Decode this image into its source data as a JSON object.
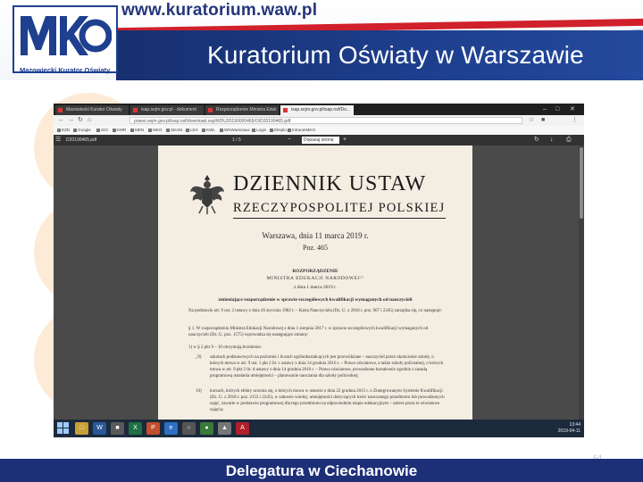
{
  "header": {
    "url": "www.kuratorium.waw.pl",
    "title": "Kuratorium Oświaty w Warszawie",
    "logo_text": "MKO",
    "logo_caption": "Mazowiecki Kurator Oświaty"
  },
  "browser": {
    "tabs": [
      {
        "label": "Mazowiecki Kurator Oświaty"
      },
      {
        "label": "isap.sejm.gov.pl - dokument"
      },
      {
        "label": "Rozporządzenie Ministra Eduk"
      },
      {
        "label": "isap.sejm.gov.pl/isap.nsf/Do..."
      }
    ],
    "url": "prawo.sejm.gov.pl/isap.nsf/download.xsp/WDU20190000465/O/D20190465.pdf",
    "bookmarks": [
      "EZD",
      "Google",
      "SIO",
      "KMR",
      "MEN",
      "MKO",
      "SEAM",
      "LEX",
      "KWL",
      "WKWarszawa",
      "Login",
      "Eksplo",
      "IntranetMKO"
    ]
  },
  "pdf": {
    "file_name": "D20190465.pdf",
    "page_indicator": "1 / 5",
    "zoom": "Dopasuj stronę",
    "title": "DZIENNIK USTAW",
    "subtitle": "RZECZYPOSPOLITEJ POLSKIEJ",
    "date": "Warszawa, dnia 11 marca 2019 r.",
    "position": "Poz. 465",
    "act_type": "ROZPORZĄDZENIE",
    "ministry": "MINISTRA EDUKACJI NARODOWEJ¹⁾",
    "act_date": "z dnia 1 marca 2019 r.",
    "act_subject": "zmieniające rozporządzenie w sprawie szczegółowych kwalifikacji wymaganych od nauczycieli",
    "intro": "Na podstawie art. 9 ust. 2 ustawy z dnia 26 stycznia 1982 r. – Karta Nauczyciela (Dz. U. z 2018 r. poz. 967 i 2245) zarządza się, co następuje:",
    "para1": "§ 1. W rozporządzeniu Ministra Edukacji Narodowej z dnia 1 sierpnia 2017 r. w sprawie szczegółowych kwalifikacji wymaganych od nauczycieli (Dz. U. poz. 1575) wprowadza się następujące zmiany:",
    "point1": "1)   w § 2 pkt 9 – 10 otrzymują brzmienie:",
    "item9_label": "„9)",
    "item9": "szkołach podstawowych na poziomie i liceach ogólnokształcących jest przewidziane – nauczyciel przez ukończenie szkoły, o których mowa w art. 9 ust. 1 pkt 2 lit. c ustawy z dnia 14 grudnia 2016 r. – Prawo oświatowe, a także szkoły policealnej, o których mowa w art. 9 pkt 2 lit. d ustawy z dnia 14 grudnia 2016 r. – Prawo oświatowe, prowadzone kształcenie zgodnie z zasadą programową ustalania umiejętności – planowanie nauczania dla szkoły policealnej;",
    "item10_label": "10)",
    "item10": "kursach, których efekty uczenia się, o których mowa w ustawie z dnia 22 grudnia 2015 r. o Zintegrowanym Systemie Kwalifikacji (Dz. U. z 2018 r. poz. 2153 i 2245), w zakresie wiedzy, umiejętności dotyczących treści nauczanego przedmiotu lub prowadzonych zajęć, zawarte w podstawie programowej dla tego przedmiotu na odpowiednim etapie edukacyjnym – zakres przez te oświatowe zajęcia;"
  },
  "taskbar": {
    "time": "13:44",
    "date": "2019-04-11"
  },
  "footer": {
    "text": "Delegatura w Ciechanowie",
    "page_number": "64"
  },
  "colors": {
    "navy": "#1d2f77",
    "red": "#d0202b",
    "header_blue": "#17306f",
    "circle_peach": "#fdebd8"
  }
}
